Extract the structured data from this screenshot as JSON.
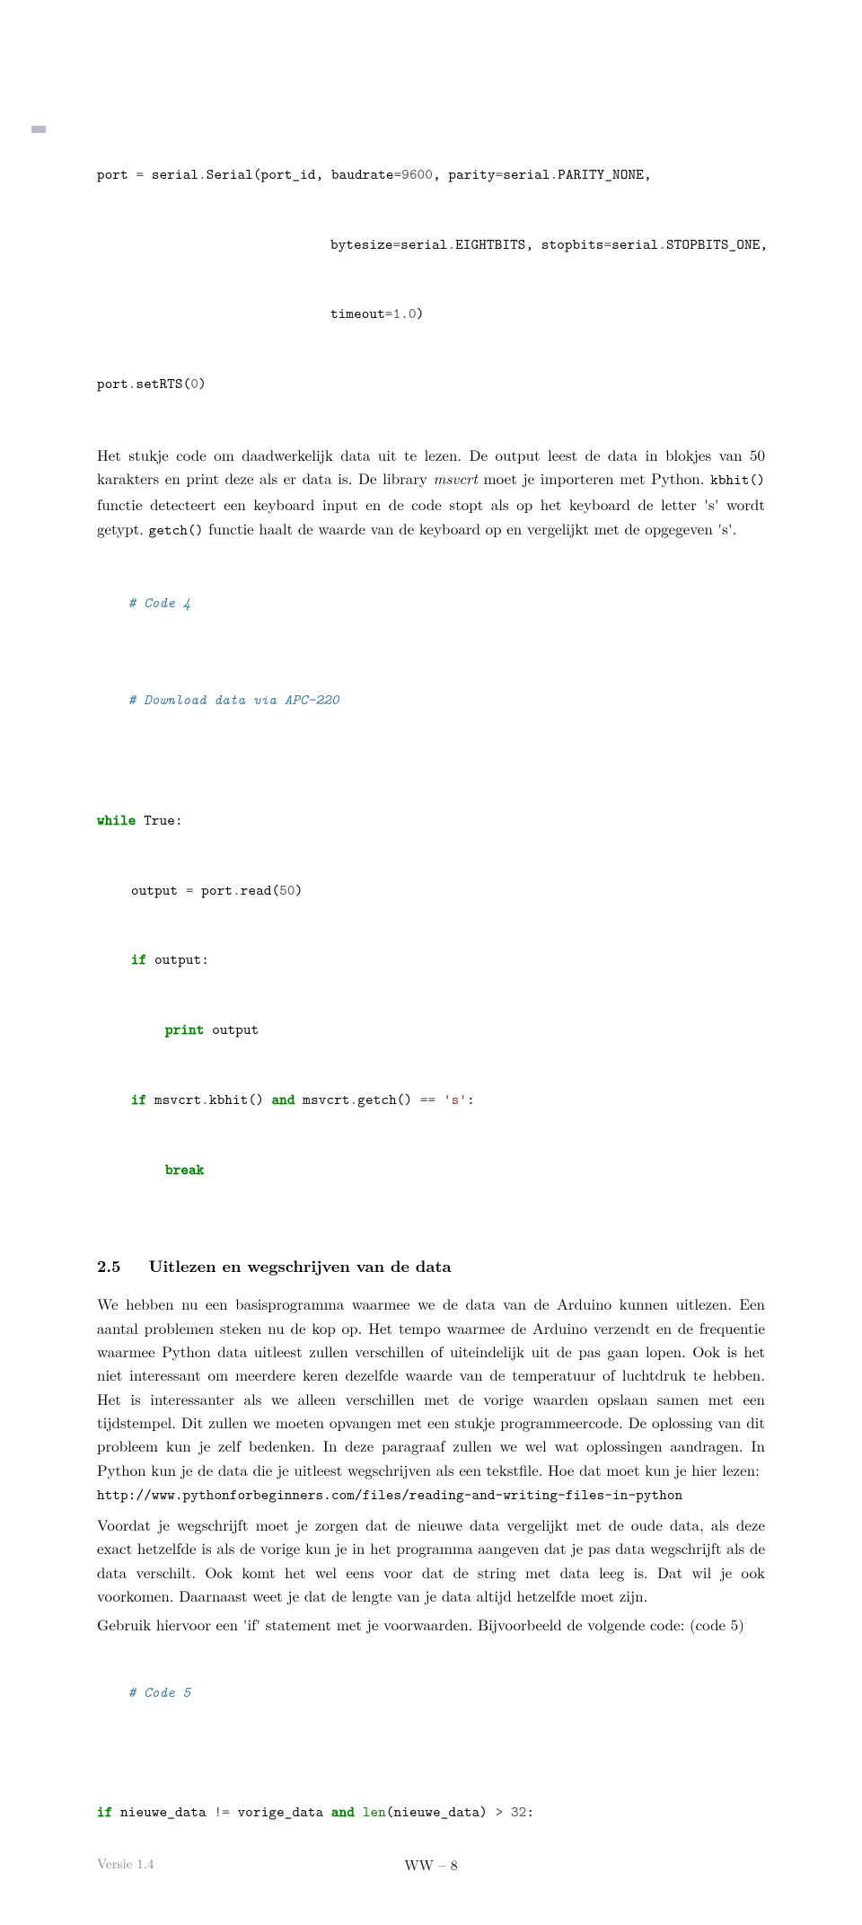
{
  "code1": {
    "l1a": "port ",
    "l1b": " serial",
    "l1c": "Serial(port_id, baudrate",
    "l1d": "9600",
    "l1e": ", parity",
    "l1f": "serial",
    "l1g": "PARITY_NONE,",
    "l2a": "bytesize",
    "l2b": "serial",
    "l2c": "EIGHTBITS, stopbits",
    "l2d": "serial",
    "l2e": "STOPBITS_ONE,",
    "l3a": "timeout",
    "l3b": "1.0",
    "l3c": ")",
    "l4a": "port",
    "l4b": "setRTS(",
    "l4c": "0",
    "l4d": ")"
  },
  "para1": {
    "t1": "Het stukje code om daadwerkelijk data uit te lezen. De output leest de data in blokjes van 50 karakters en print deze als er data is. De library ",
    "t2": "msvcrt",
    "t3": " moet je importeren met Python. ",
    "t4": "kbhit()",
    "t5": " functie detecteert een keyboard input en de code stopt als op het keyboard de letter 's' wordt getypt. ",
    "t6": "getch()",
    "t7": " functie haalt de waarde van de keyboard op en vergelijkt met de opgegeven 's'."
  },
  "comments": {
    "c4": "# Code 4",
    "dl": "# Download data via APC-220",
    "c5": "# Code 5"
  },
  "code2": {
    "while": "while",
    "true": " True:",
    "out1a": "output ",
    "out1b": " port",
    "out1c": "read(",
    "out1d": "50",
    "out1e": ")",
    "if1a": "if",
    "if1b": " output:",
    "print": "print",
    "printb": " output",
    "if2a": "if",
    "if2b": " msvcrt",
    "if2c": "kbhit() ",
    "and": "and",
    "if2d": " msvcrt",
    "if2e": "getch() ",
    "eqeq": "==",
    "if2f": " ",
    "str": "'s'",
    "if2g": ":",
    "break": "break"
  },
  "section": {
    "num": "2.5",
    "title": "Uitlezen en wegschrijven van de data"
  },
  "para2": {
    "t1": "We hebben nu een basisprogramma waarmee we de data van de Arduino kunnen uitlezen. Een aantal problemen steken nu de kop op. Het tempo waarmee de Arduino verzendt en de frequentie waarmee Python data uitleest zullen verschillen of uiteindelijk uit de pas gaan lopen. Ook is het niet interessant om meerdere keren dezelfde waarde van de temperatuur of luchtdruk te hebben. Het is interessanter als we alleen verschillen met de vorige waarden opslaan samen met een tijdstempel. Dit zullen we moeten opvangen met een stukje programmeercode. De oplossing van dit probleem kun je zelf bedenken. In deze paragraaf zullen we wel wat oplossingen aandragen. In Python kun je de data die je uitleest wegschrijven als een tekstfile. Hoe dat moet kun je hier lezen: ",
    "url": "http://www.pythonforbeginners.com/files/reading-and-writing-files-in-python"
  },
  "para3": "Voordat je wegschrijft moet je zorgen dat de nieuwe data vergelijkt met de oude data, als deze exact hetzelfde is als de vorige kun je in het programma aangeven dat je pas data wegschrijft als de data verschilt. Ook komt het wel eens voor dat de string met data leeg is. Dat wil je ook voorkomen. Daarnaast weet je dat de lengte van je data altijd hetzelfde moet zijn.",
  "para4": "Gebruik hiervoor een 'if' statement met je voorwaarden. Bijvoorbeeld de volgende code: (code 5)",
  "code3": {
    "if": "if",
    "a": " nieuwe_data ",
    "ne": "!=",
    "b": " vorige_data ",
    "and": "and",
    "c": " ",
    "len": "len",
    "d": "(nieuwe_data) ",
    "gt": ">",
    "e": " ",
    "num": "32",
    "f": ":"
  },
  "footer": {
    "version": "Versie 1.4",
    "page": "WW – 8"
  }
}
